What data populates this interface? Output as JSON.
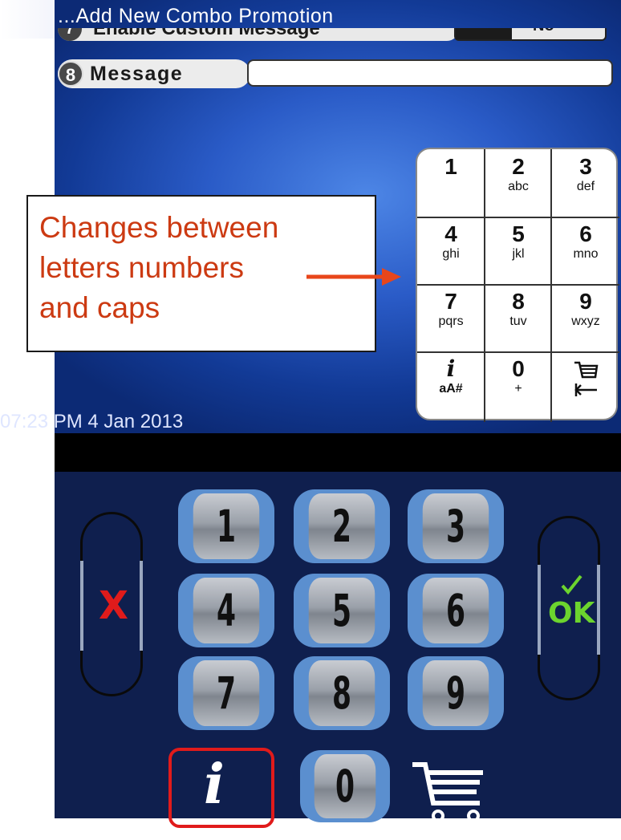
{
  "screen": {
    "title": "...Add New Combo Promotion",
    "row7": {
      "number": "7",
      "label": "Enable Custom Message",
      "value": "No"
    },
    "row8": {
      "number": "8",
      "label": "Message",
      "input_value": ""
    },
    "timestamp": "07:23 PM 4 Jan 2013"
  },
  "screen_keypad": {
    "keys": [
      {
        "digit": "1",
        "letters": ""
      },
      {
        "digit": "2",
        "letters": "abc"
      },
      {
        "digit": "3",
        "letters": "def"
      },
      {
        "digit": "4",
        "letters": "ghi"
      },
      {
        "digit": "5",
        "letters": "jkl"
      },
      {
        "digit": "6",
        "letters": "mno"
      },
      {
        "digit": "7",
        "letters": "pqrs"
      },
      {
        "digit": "8",
        "letters": "tuv"
      },
      {
        "digit": "9",
        "letters": "wxyz"
      },
      {
        "digit": "i",
        "letters": "aA#"
      },
      {
        "digit": "0",
        "letters": "+"
      },
      {
        "digit": "cart-icon",
        "letters": ""
      }
    ]
  },
  "hardware_keypad": {
    "digits": [
      "1",
      "2",
      "3",
      "4",
      "5",
      "6",
      "7",
      "8",
      "9",
      "0"
    ],
    "cancel_label": "X",
    "ok_label": "OK",
    "info_label": "i"
  },
  "callout": {
    "lines": [
      "Changes between",
      "letters numbers",
      "and caps"
    ]
  },
  "colors": {
    "callout_text": "#cc3a12",
    "highlight": "#e01b1b",
    "ok": "#6cd42e"
  }
}
